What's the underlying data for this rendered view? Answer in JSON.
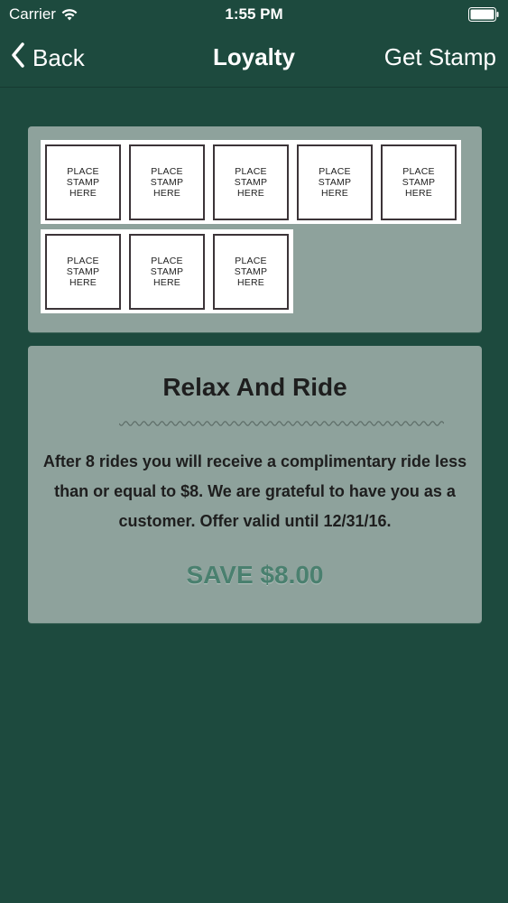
{
  "status_bar": {
    "carrier": "Carrier",
    "time": "1:55 PM",
    "wifi_icon": "wifi-icon",
    "battery_icon": "battery-icon"
  },
  "nav": {
    "back_label": "Back",
    "back_icon": "chevron-left-icon",
    "title": "Loyalty",
    "action_label": "Get Stamp"
  },
  "stamp_card": {
    "total_stamps": 8,
    "stamps": [
      {
        "label": "PLACE\nSTAMP\nHERE"
      },
      {
        "label": "PLACE\nSTAMP\nHERE"
      },
      {
        "label": "PLACE\nSTAMP\nHERE"
      },
      {
        "label": "PLACE\nSTAMP\nHERE"
      },
      {
        "label": "PLACE\nSTAMP\nHERE"
      },
      {
        "label": "PLACE\nSTAMP\nHERE"
      },
      {
        "label": "PLACE\nSTAMP\nHERE"
      },
      {
        "label": "PLACE\nSTAMP\nHERE"
      }
    ]
  },
  "offer": {
    "title": "Relax And Ride",
    "description": "After 8 rides you will receive a complimentary ride less than or equal to $8. We are grateful to have you as a customer. Offer valid until 12/31/16.",
    "savings": "SAVE $8.00"
  },
  "colors": {
    "background": "#1d4a3e",
    "panel": "#8ea29c",
    "savings_text": "#4a806f",
    "stamp_border": "#3c3438"
  }
}
